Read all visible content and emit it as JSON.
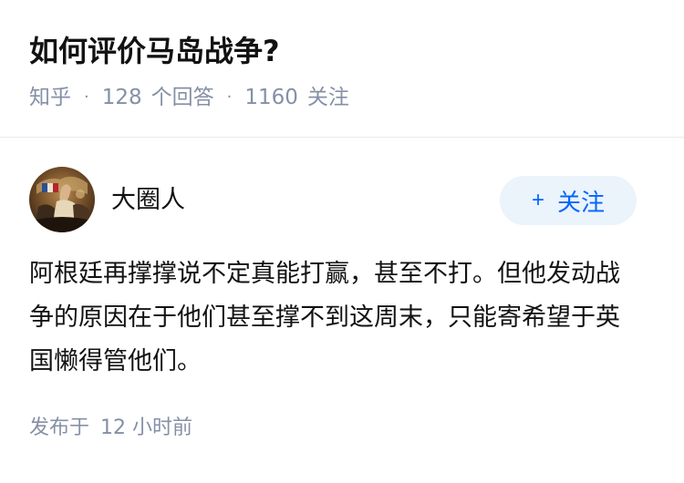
{
  "question": {
    "title": "如何评价马岛战争?",
    "source": "知乎",
    "answers_count": "128",
    "answers_label": "个回答",
    "followers_count": "1160",
    "followers_label": "关注",
    "separator": "·"
  },
  "answer": {
    "author": {
      "name": "大圈人",
      "avatar_icon": "avatar-painting-icon"
    },
    "follow_button": {
      "icon": "plus-icon",
      "icon_glyph": "+",
      "label": "关注"
    },
    "content": "阿根廷再撑撑说不定真能打赢，甚至不打。但他发动战争的原因在于他们甚至撑不到这周末，只能寄希望于英国懒得管他们。",
    "footer": {
      "published_label": "发布于",
      "published_time": "12 小时前"
    }
  },
  "colors": {
    "title": "#121212",
    "meta": "#8590a6",
    "accent": "#0066ff",
    "follow_bg": "#ebf3fb",
    "divider": "#ebebeb"
  }
}
